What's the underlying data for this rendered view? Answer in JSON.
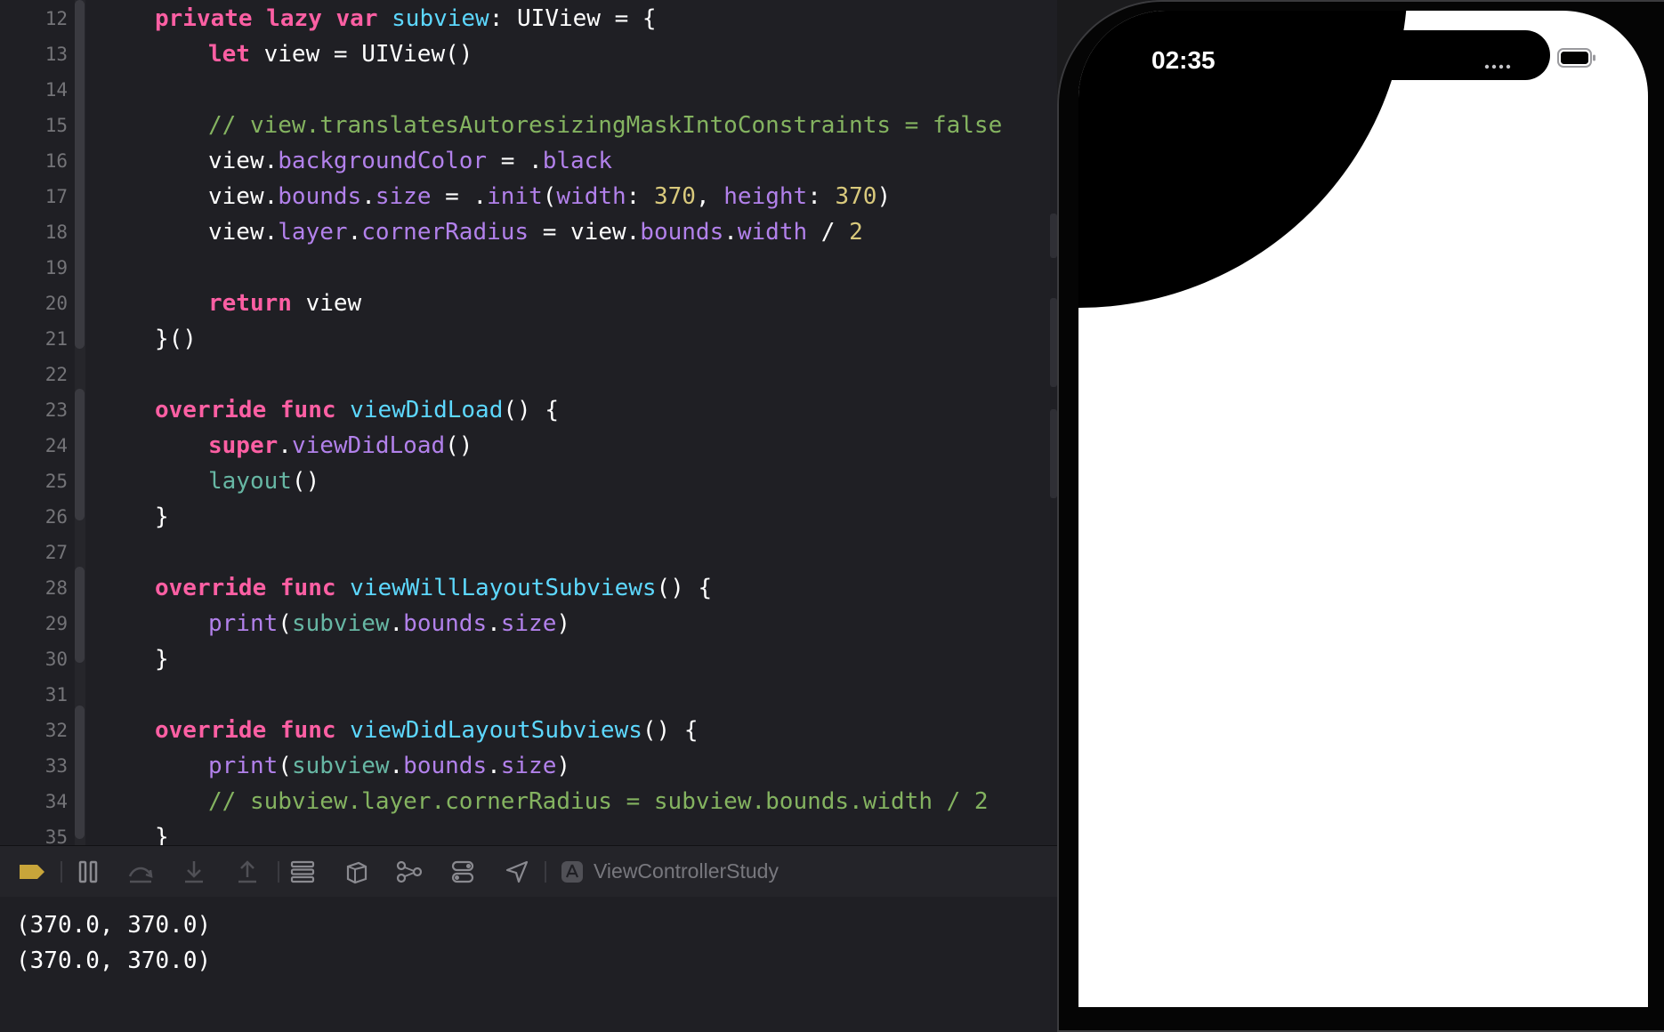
{
  "editor": {
    "lines": [
      {
        "num": "12",
        "indent": 1,
        "tokens": [
          [
            "kw",
            "private"
          ],
          [
            "pl",
            " "
          ],
          [
            "kw",
            "lazy"
          ],
          [
            "pl",
            " "
          ],
          [
            "kw",
            "var"
          ],
          [
            "pl",
            " "
          ],
          [
            "decl",
            "subview"
          ],
          [
            "pl",
            ": UIView = {"
          ]
        ]
      },
      {
        "num": "13",
        "indent": 2,
        "tokens": [
          [
            "kw",
            "let"
          ],
          [
            "pl",
            " view = UIView()"
          ]
        ]
      },
      {
        "num": "14",
        "indent": 0,
        "tokens": []
      },
      {
        "num": "15",
        "indent": 2,
        "tokens": [
          [
            "com",
            "// view.translatesAutoresizingMaskIntoConstraints = false"
          ]
        ]
      },
      {
        "num": "16",
        "indent": 2,
        "tokens": [
          [
            "pl",
            "view."
          ],
          [
            "prop",
            "backgroundColor"
          ],
          [
            "pl",
            " = ."
          ],
          [
            "prop",
            "black"
          ]
        ]
      },
      {
        "num": "17",
        "indent": 2,
        "tokens": [
          [
            "pl",
            "view."
          ],
          [
            "prop",
            "bounds"
          ],
          [
            "pl",
            "."
          ],
          [
            "prop",
            "size"
          ],
          [
            "pl",
            " = ."
          ],
          [
            "prop",
            "init"
          ],
          [
            "pl",
            "("
          ],
          [
            "prop",
            "width"
          ],
          [
            "pl",
            ": "
          ],
          [
            "num",
            "370"
          ],
          [
            "pl",
            ", "
          ],
          [
            "prop",
            "height"
          ],
          [
            "pl",
            ": "
          ],
          [
            "num",
            "370"
          ],
          [
            "pl",
            ")"
          ]
        ]
      },
      {
        "num": "18",
        "indent": 2,
        "tokens": [
          [
            "pl",
            "view."
          ],
          [
            "prop",
            "layer"
          ],
          [
            "pl",
            "."
          ],
          [
            "prop",
            "cornerRadius"
          ],
          [
            "pl",
            " = view."
          ],
          [
            "prop",
            "bounds"
          ],
          [
            "pl",
            "."
          ],
          [
            "prop",
            "width"
          ],
          [
            "pl",
            " / "
          ],
          [
            "num",
            "2"
          ]
        ]
      },
      {
        "num": "19",
        "indent": 0,
        "tokens": []
      },
      {
        "num": "20",
        "indent": 2,
        "tokens": [
          [
            "kw",
            "return"
          ],
          [
            "pl",
            " view"
          ]
        ]
      },
      {
        "num": "21",
        "indent": 1,
        "tokens": [
          [
            "pl",
            "}()"
          ]
        ]
      },
      {
        "num": "22",
        "indent": 0,
        "tokens": []
      },
      {
        "num": "23",
        "indent": 1,
        "tokens": [
          [
            "kw",
            "override"
          ],
          [
            "pl",
            " "
          ],
          [
            "kw",
            "func"
          ],
          [
            "pl",
            " "
          ],
          [
            "decl",
            "viewDidLoad"
          ],
          [
            "pl",
            "() {"
          ]
        ]
      },
      {
        "num": "24",
        "indent": 2,
        "tokens": [
          [
            "kw",
            "super"
          ],
          [
            "pl",
            "."
          ],
          [
            "prop",
            "viewDidLoad"
          ],
          [
            "pl",
            "()"
          ]
        ]
      },
      {
        "num": "25",
        "indent": 2,
        "tokens": [
          [
            "fn",
            "layout"
          ],
          [
            "pl",
            "()"
          ]
        ]
      },
      {
        "num": "26",
        "indent": 1,
        "tokens": [
          [
            "pl",
            "}"
          ]
        ]
      },
      {
        "num": "27",
        "indent": 0,
        "tokens": []
      },
      {
        "num": "28",
        "indent": 1,
        "tokens": [
          [
            "kw",
            "override"
          ],
          [
            "pl",
            " "
          ],
          [
            "kw",
            "func"
          ],
          [
            "pl",
            " "
          ],
          [
            "decl",
            "viewWillLayoutSubviews"
          ],
          [
            "pl",
            "() {"
          ]
        ]
      },
      {
        "num": "29",
        "indent": 2,
        "tokens": [
          [
            "prop",
            "print"
          ],
          [
            "pl",
            "("
          ],
          [
            "fn",
            "subview"
          ],
          [
            "pl",
            "."
          ],
          [
            "prop",
            "bounds"
          ],
          [
            "pl",
            "."
          ],
          [
            "prop",
            "size"
          ],
          [
            "pl",
            ")"
          ]
        ]
      },
      {
        "num": "30",
        "indent": 1,
        "tokens": [
          [
            "pl",
            "}"
          ]
        ]
      },
      {
        "num": "31",
        "indent": 0,
        "tokens": []
      },
      {
        "num": "32",
        "indent": 1,
        "tokens": [
          [
            "kw",
            "override"
          ],
          [
            "pl",
            " "
          ],
          [
            "kw",
            "func"
          ],
          [
            "pl",
            " "
          ],
          [
            "decl",
            "viewDidLayoutSubviews"
          ],
          [
            "pl",
            "() {"
          ]
        ]
      },
      {
        "num": "33",
        "indent": 2,
        "tokens": [
          [
            "prop",
            "print"
          ],
          [
            "pl",
            "("
          ],
          [
            "fn",
            "subview"
          ],
          [
            "pl",
            "."
          ],
          [
            "prop",
            "bounds"
          ],
          [
            "pl",
            "."
          ],
          [
            "prop",
            "size"
          ],
          [
            "pl",
            ")"
          ]
        ]
      },
      {
        "num": "34",
        "indent": 2,
        "tokens": [
          [
            "com",
            "// subview.layer.cornerRadius = subview.bounds.width / 2"
          ]
        ]
      },
      {
        "num": "35",
        "indent": 1,
        "tokens": [
          [
            "pl",
            "}"
          ]
        ]
      }
    ]
  },
  "debug_bar": {
    "target": "ViewControllerStudy",
    "icons": [
      "breakpoint-toggle-icon",
      "pause-icon",
      "step-over-icon",
      "step-into-icon",
      "step-out-icon",
      "debug-view-hierarchy-icon",
      "memory-graph-icon",
      "environment-overrides-icon",
      "simulate-location-icon",
      "location-arrow-icon",
      "app-target-icon"
    ]
  },
  "console": {
    "lines": [
      "(370.0, 370.0)",
      "(370.0, 370.0)"
    ]
  },
  "simulator": {
    "time": "02:35"
  },
  "colors": {
    "keyword": "#fc5fa3",
    "function": "#67b7a4",
    "property": "#b281eb",
    "number": "#d9c97c",
    "comment": "#84b360",
    "declaration": "#5dd8ff",
    "breakpoint": "#c8a53a"
  }
}
